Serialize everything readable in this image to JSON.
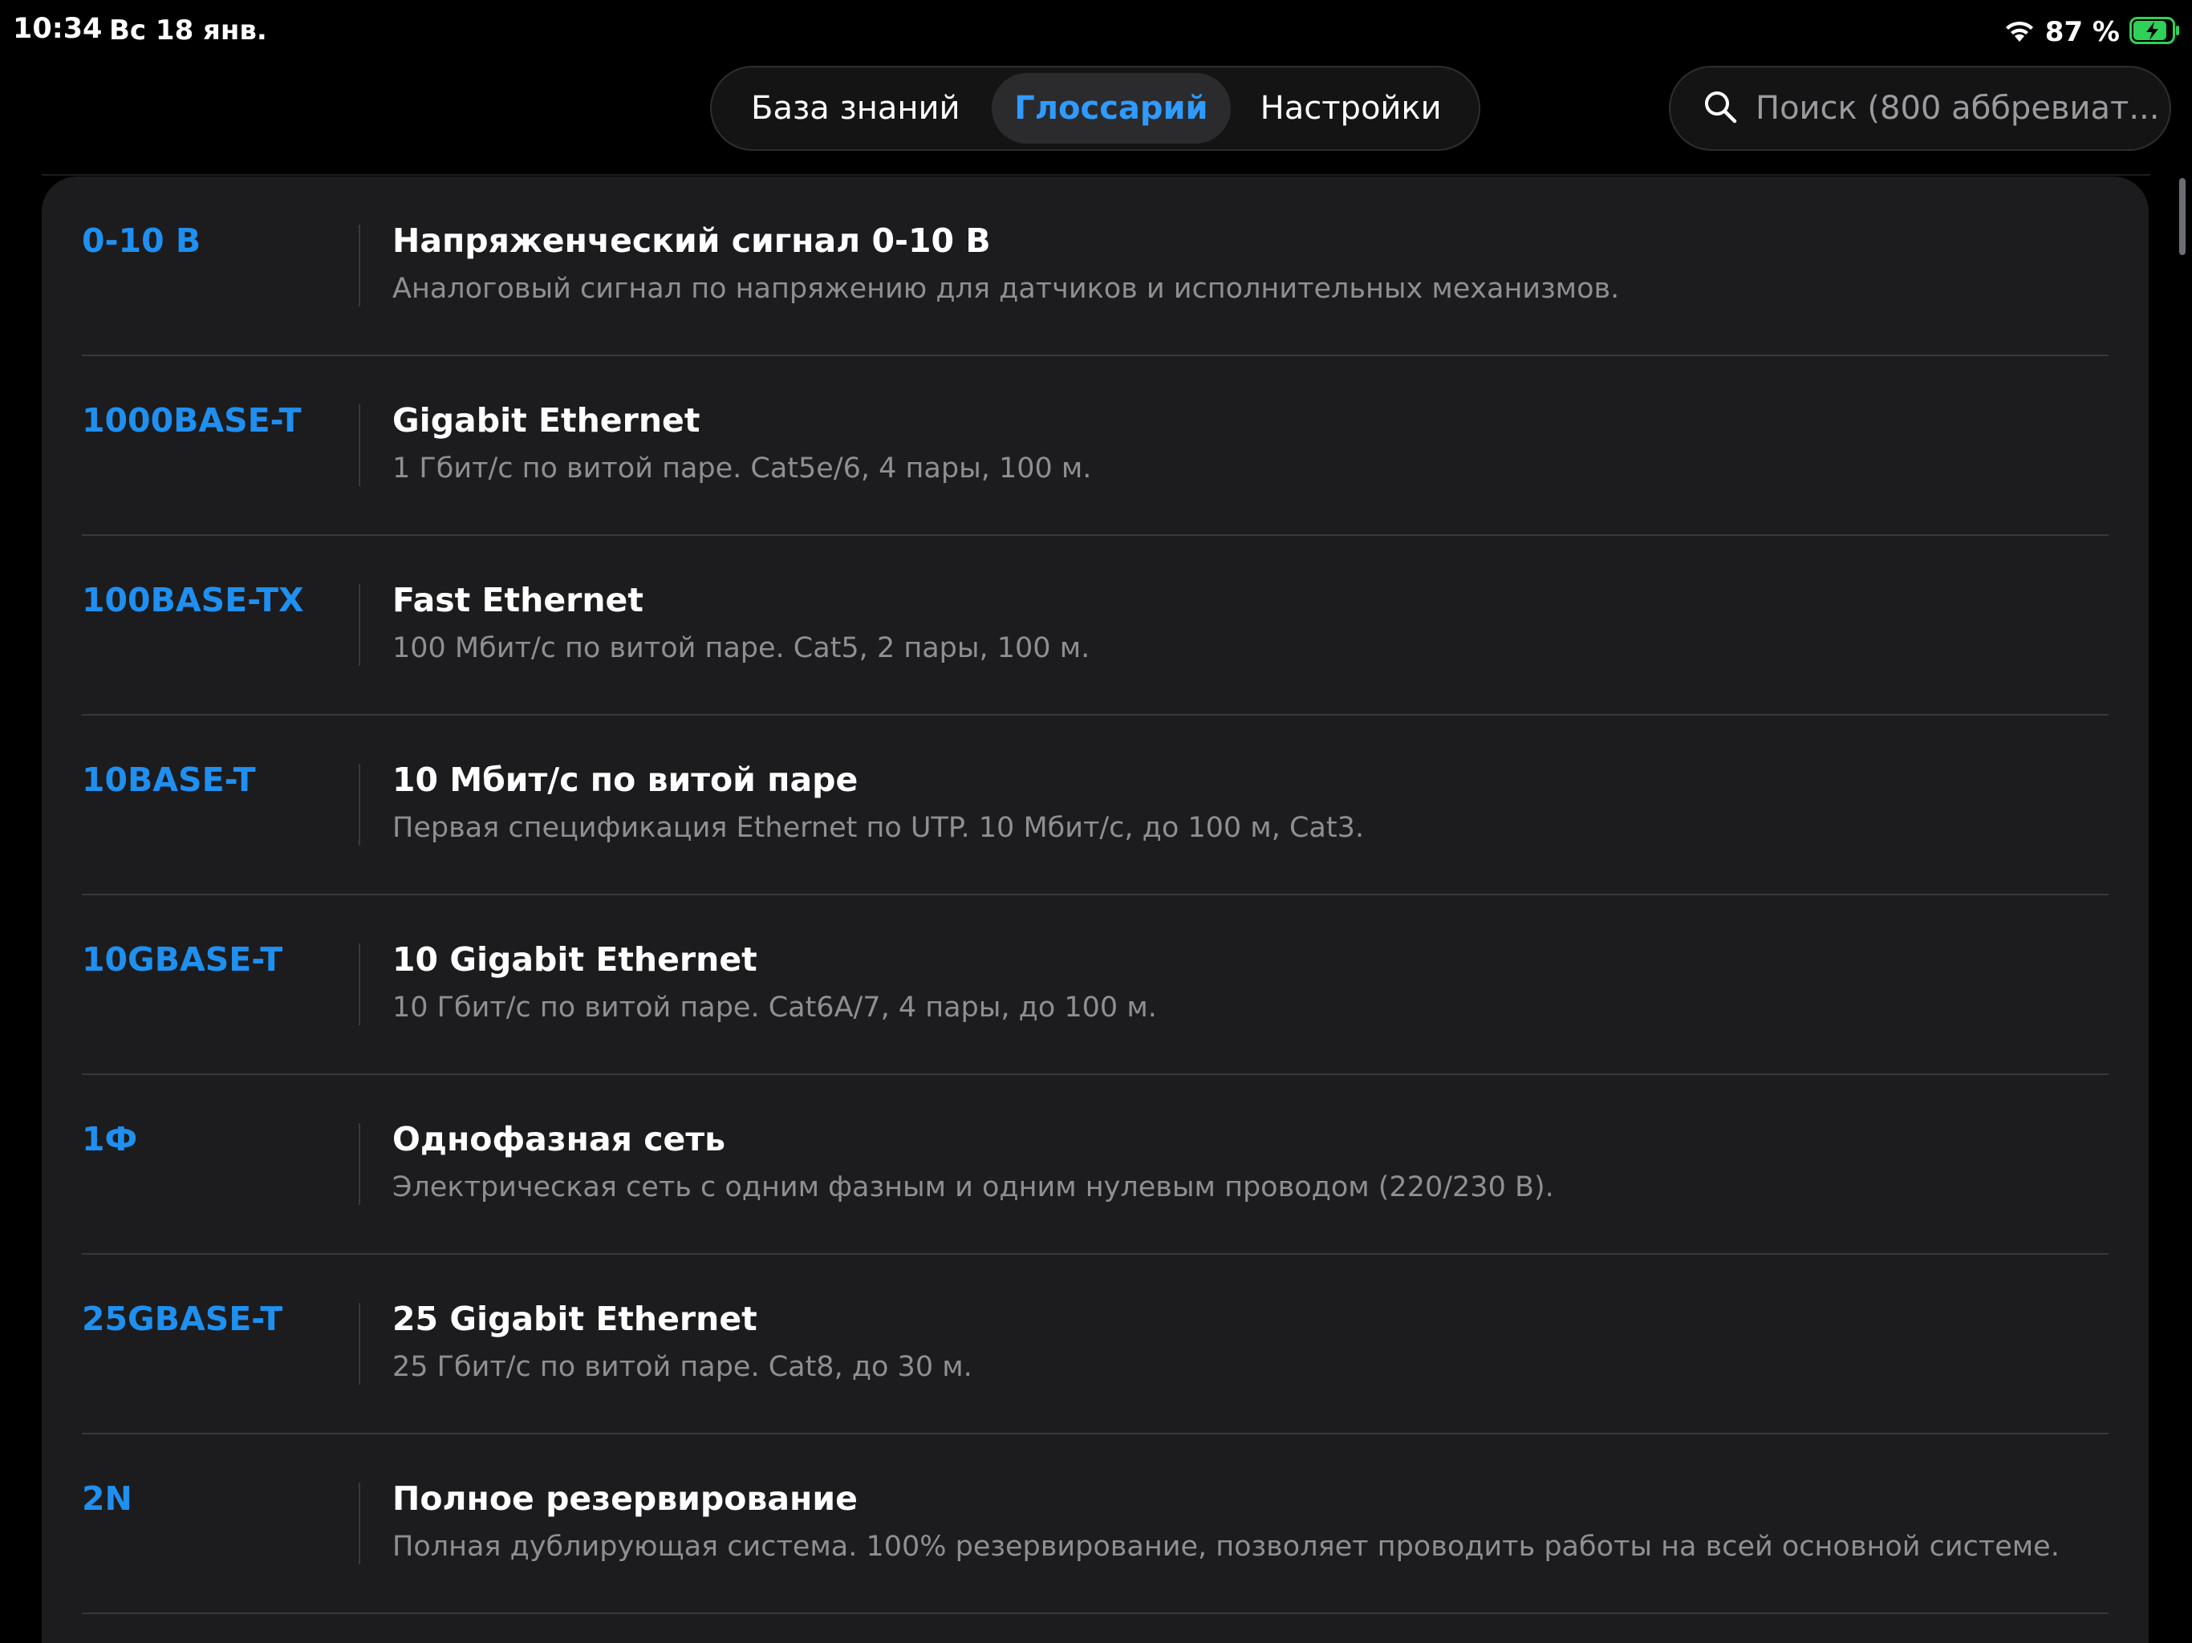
{
  "status_bar": {
    "time": "10:34",
    "date": "Вс 18 янв.",
    "battery_percent": "87 %",
    "battery_level": 0.87,
    "charging": true,
    "battery_color": "#30d158"
  },
  "tabs": [
    {
      "label": "База знаний",
      "active": false
    },
    {
      "label": "Глоссарий",
      "active": true
    },
    {
      "label": "Настройки",
      "active": false
    }
  ],
  "search": {
    "placeholder": "Поиск (800 аббревиат..."
  },
  "colors": {
    "accent": "#1f8ff0",
    "active_tab_text": "#2f9bff",
    "background": "#000000",
    "panel": "#1c1c1e",
    "secondary_text": "#8e8e93"
  },
  "glossary": [
    {
      "abbr": "0-10 В",
      "term": "Напряженческий сигнал 0-10 В",
      "desc": "Аналоговый сигнал по напряжению для датчиков и исполнительных механизмов."
    },
    {
      "abbr": "1000BASE-T",
      "term": "Gigabit Ethernet",
      "desc": "1 Гбит/с по витой паре. Cat5e/6, 4 пары, 100 м."
    },
    {
      "abbr": "100BASE-TX",
      "term": "Fast Ethernet",
      "desc": "100 Мбит/с по витой паре. Cat5, 2 пары, 100 м."
    },
    {
      "abbr": "10BASE-T",
      "term": "10 Мбит/с по витой паре",
      "desc": "Первая спецификация Ethernet по UTP. 10 Мбит/с, до 100 м, Cat3."
    },
    {
      "abbr": "10GBASE-T",
      "term": "10 Gigabit Ethernet",
      "desc": "10 Гбит/с по витой паре. Cat6A/7, 4 пары, до 100 м."
    },
    {
      "abbr": "1Ф",
      "term": "Однофазная сеть",
      "desc": "Электрическая сеть с одним фазным и одним нулевым проводом (220/230 В)."
    },
    {
      "abbr": "25GBASE-T",
      "term": "25 Gigabit Ethernet",
      "desc": "25 Гбит/с по витой паре. Cat8, до 30 м."
    },
    {
      "abbr": "2N",
      "term": "Полное резервирование",
      "desc": "Полная дублирующая система. 100% резервирование, позволяет проводить работы на всей основной системе."
    }
  ]
}
